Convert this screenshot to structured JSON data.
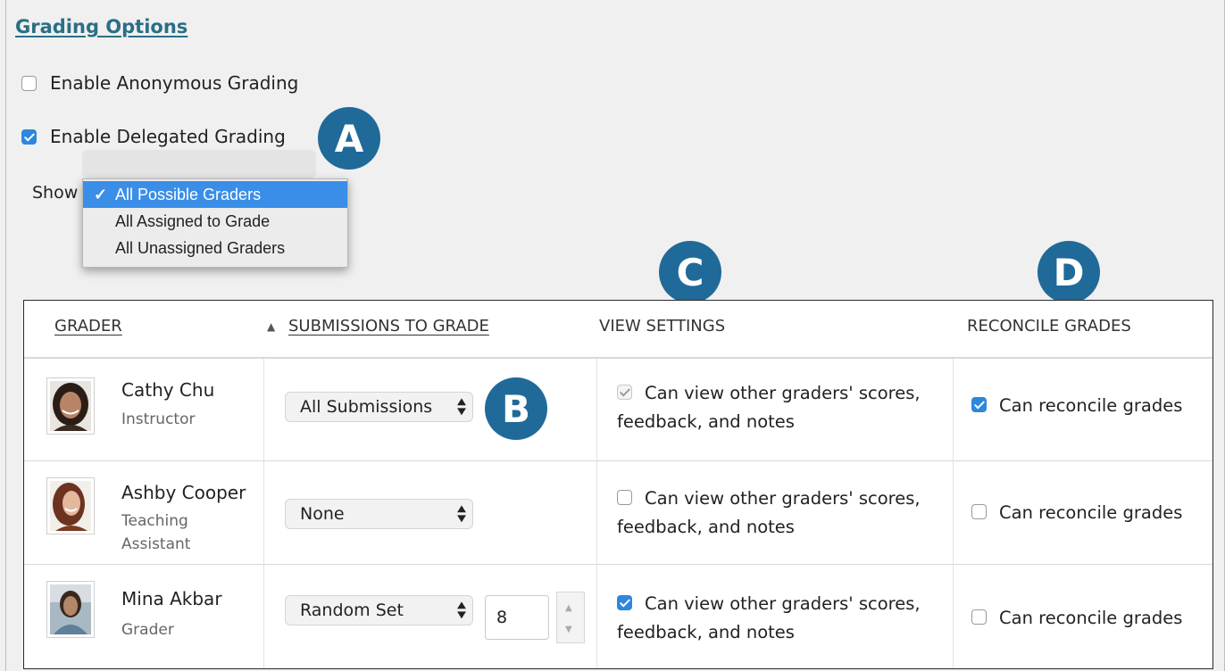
{
  "section_title": "Grading Options",
  "options": {
    "anonymous": {
      "label": "Enable Anonymous Grading",
      "checked": false
    },
    "delegated": {
      "label": "Enable Delegated Grading",
      "checked": true
    }
  },
  "show": {
    "label": "Show",
    "options": [
      "All Possible Graders",
      "All Assigned to Grade",
      "All Unassigned Graders"
    ],
    "selected": "All Possible Graders",
    "check_glyph": "✓"
  },
  "callouts": {
    "a": "A",
    "b": "B",
    "c": "C",
    "d": "D"
  },
  "table": {
    "headers": {
      "grader": "GRADER",
      "submissions": "SUBMISSIONS TO GRADE",
      "sort_glyph": "▲",
      "view": "VIEW SETTINGS",
      "reconcile": "RECONCILE GRADES"
    },
    "rows": [
      {
        "name": "Cathy Chu",
        "role": "Instructor",
        "submissions": "All Submissions",
        "view_label_1": "Can view other graders' scores,",
        "view_label_2": "feedback, and notes",
        "view_state": "checked-disabled",
        "reconcile_label": "Can reconcile grades",
        "reconcile_checked": true
      },
      {
        "name": "Ashby Cooper",
        "role_1": "Teaching",
        "role_2": "Assistant",
        "submissions": "None",
        "view_label_1": "Can view other graders' scores,",
        "view_label_2": "feedback, and notes",
        "view_state": "unchecked",
        "reconcile_label": "Can reconcile grades",
        "reconcile_checked": false
      },
      {
        "name": "Mina Akbar",
        "role": "Grader",
        "submissions": "Random Set",
        "random_count": "8",
        "view_label_1": "Can view other graders' scores,",
        "view_label_2": "feedback, and notes",
        "view_state": "checked",
        "reconcile_label": "Can reconcile grades",
        "reconcile_checked": false
      }
    ]
  },
  "colors": {
    "link": "#2a6f86",
    "callout": "#1f6a99",
    "checkbox_checked": "#2d87dc",
    "dropdown_highlight": "#3a8ee8"
  }
}
